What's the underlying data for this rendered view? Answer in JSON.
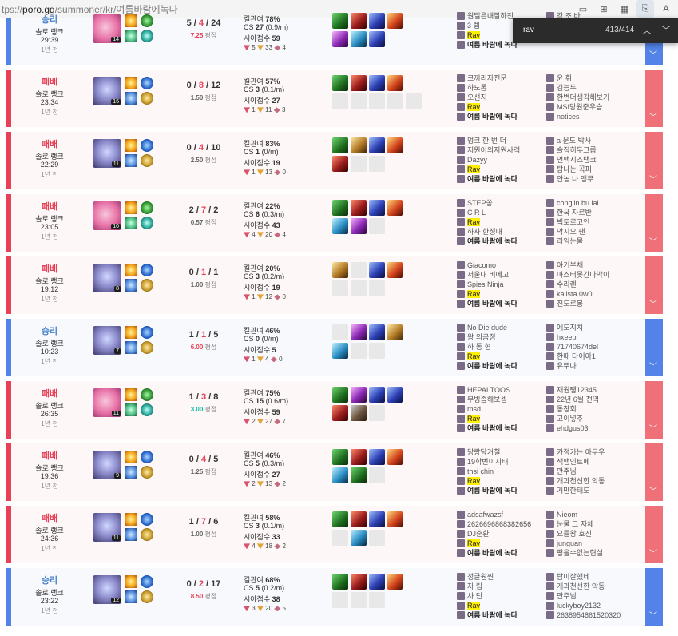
{
  "browser": {
    "url_prefix": "tps://",
    "url_domain": "poro.gg",
    "url_path": "/summoner/kr/여름바람에녹다"
  },
  "find": {
    "query": "rav",
    "count": "413/414"
  },
  "labels": {
    "kp": "킬관여",
    "cs": "CS",
    "vision": "시야점수",
    "avg": "평점"
  },
  "matches": [
    {
      "result": "승리",
      "status": "win",
      "queue": "솔로 랭크",
      "duration": "29:39",
      "ago": "1년 전",
      "champ": "seraphine",
      "level": "14",
      "spells": [
        "flash",
        "ghost"
      ],
      "runes": [
        "rune-g",
        "rune-t"
      ],
      "kills": "5",
      "deaths": "4",
      "assists": "24",
      "ratio": "7.25",
      "ratio_color": "red",
      "kp": "78%",
      "cs": "27",
      "cspm": "(0.9/m)",
      "vision": "59",
      "wards": [
        "5",
        "33",
        "4"
      ],
      "items": [
        "i-a",
        "i-b",
        "i-c",
        "i-d",
        "i-e",
        "i-f",
        "i-c"
      ],
      "team1": [
        "원딜은내잘하진",
        "3 렙",
        "Rav",
        "여름 바람에 녹다"
      ],
      "team2": [
        "강 조 바",
        "애기 미드"
      ],
      "first": true
    },
    {
      "result": "패배",
      "status": "loss",
      "queue": "솔로 랭크",
      "duration": "23:34",
      "ago": "1년 전",
      "champ": "gnar",
      "level": "16",
      "spells": [
        "flash",
        "mark"
      ],
      "runes": [
        "rune-b",
        "rune-y"
      ],
      "kills": "0",
      "deaths": "8",
      "assists": "12",
      "ratio": "1.50",
      "ratio_color": "",
      "kp": "57%",
      "cs": "3",
      "cspm": "(0.1/m)",
      "vision": "27",
      "wards": [
        "1",
        "11",
        "3"
      ],
      "items": [
        "i-a",
        "i-b",
        "i-c",
        "i-d",
        "",
        "",
        "",
        "",
        ""
      ],
      "team1": [
        "코끼리자전문",
        "하도롱",
        "오선지",
        "Rav",
        "여름 바람에 녹다"
      ],
      "team2": [
        "윤 휘",
        "김능두",
        "한변더생각해보기",
        "MSI당원준우승",
        "notices"
      ]
    },
    {
      "result": "패배",
      "status": "loss",
      "queue": "솔로 랭크",
      "duration": "22:29",
      "ago": "1년 전",
      "champ": "gnar",
      "level": "11",
      "spells": [
        "flash",
        "mark"
      ],
      "runes": [
        "rune-b",
        "rune-y"
      ],
      "kills": "0",
      "deaths": "4",
      "assists": "10",
      "ratio": "2.50",
      "ratio_color": "",
      "kp": "83%",
      "cs": "1",
      "cspm": "(0/m)",
      "vision": "19",
      "wards": [
        "1",
        "13",
        "0"
      ],
      "items": [
        "i-a",
        "i-g",
        "i-c",
        "i-d",
        "i-b",
        "",
        ""
      ],
      "team1": [
        "멍크 한 번 더",
        "지원이의지원사격",
        "Dazyy",
        "Rav",
        "여름 바람에 녹다"
      ],
      "team2": [
        "a 문도 박사",
        "솔직히두그룹",
        "연맥시즈탱크",
        "탐나는 꼭피",
        "안농 나 앵무"
      ]
    },
    {
      "result": "패배",
      "status": "loss",
      "queue": "솔로 랭크",
      "duration": "23:05",
      "ago": "1년 전",
      "champ": "seraphine",
      "level": "10",
      "spells": [
        "flash",
        "ghost"
      ],
      "runes": [
        "rune-g",
        "rune-t"
      ],
      "kills": "2",
      "deaths": "7",
      "assists": "2",
      "ratio": "0.57",
      "ratio_color": "",
      "kp": "22%",
      "cs": "6",
      "cspm": "(0.3/m)",
      "vision": "43",
      "wards": [
        "4",
        "20",
        "4"
      ],
      "items": [
        "i-a",
        "i-b",
        "i-c",
        "i-d",
        "i-f",
        "i-e",
        ""
      ],
      "team1": [
        "STEP쏭",
        "C R L",
        "Rav",
        "하사 한정대",
        "여름 바람에 녹다"
      ],
      "team2": [
        "conglin bu lai",
        "한국 자르반",
        "빅토르고인",
        "악시오 팬",
        "라임눈물"
      ]
    },
    {
      "result": "패배",
      "status": "loss",
      "queue": "솔로 랭크",
      "duration": "19:12",
      "ago": "1년 전",
      "champ": "gnar",
      "level": "8",
      "spells": [
        "flash",
        "mark"
      ],
      "runes": [
        "rune-b",
        "rune-y"
      ],
      "kills": "0",
      "deaths": "1",
      "assists": "1",
      "ratio": "1.00",
      "ratio_color": "",
      "kp": "20%",
      "cs": "3",
      "cspm": "(0.2/m)",
      "vision": "19",
      "wards": [
        "1",
        "12",
        "0"
      ],
      "items": [
        "i-g",
        "",
        "i-c",
        "i-d",
        "",
        "",
        ""
      ],
      "team1": [
        "Giacomo",
        "서울대 비에고",
        "Spies Ninja",
        "Rav",
        "여름 바람에 녹다"
      ],
      "team2": [
        "아기부채",
        "마스터못간다막이",
        "수리렌",
        "kalista 0w0",
        "진도로봉"
      ]
    },
    {
      "result": "승리",
      "status": "win",
      "queue": "솔로 랭크",
      "duration": "10:23",
      "ago": "1년 전",
      "champ": "gnar",
      "level": "7",
      "spells": [
        "flash",
        "mark"
      ],
      "runes": [
        "rune-b",
        "rune-y"
      ],
      "kills": "1",
      "deaths": "1",
      "assists": "5",
      "ratio": "6.00",
      "ratio_color": "red",
      "kp": "46%",
      "cs": "0",
      "cspm": "(0/m)",
      "vision": "5",
      "wards": [
        "1",
        "4",
        "0"
      ],
      "items": [
        "",
        "i-e",
        "i-c",
        "i-g",
        "i-f",
        "",
        ""
      ],
      "team1": [
        "No Die dude",
        "왕 의금정",
        "하 동 현",
        "Rav",
        "여름 바람에 녹다"
      ],
      "team2": [
        "에도지치",
        "hxeep",
        "71740674del",
        "한때 다이아1",
        "유뚜나"
      ]
    },
    {
      "result": "패배",
      "status": "loss",
      "queue": "솔로 랭크",
      "duration": "26:35",
      "ago": "1년 전",
      "champ": "seraphine",
      "level": "11",
      "spells": [
        "flash",
        "ghost"
      ],
      "runes": [
        "rune-g",
        "rune-t"
      ],
      "kills": "1",
      "deaths": "3",
      "assists": "8",
      "ratio": "3.00",
      "ratio_color": "green",
      "kp": "75%",
      "cs": "15",
      "cspm": "(0.6/m)",
      "vision": "59",
      "wards": [
        "2",
        "27",
        "7"
      ],
      "items": [
        "i-a",
        "i-e",
        "i-c",
        "i-c",
        "i-b",
        "i-h",
        ""
      ],
      "team1": [
        "HEPAI TOOS",
        "무빙좀해보셈",
        "msd",
        "Rav",
        "여름 바람에 녹다"
      ],
      "team2": [
        "재원쨍12345",
        "22년 6월 전역",
        "동창회",
        "고이넣추",
        "ehdgus03"
      ]
    },
    {
      "result": "패배",
      "status": "loss",
      "queue": "솔로 랭크",
      "duration": "19:36",
      "ago": "1년 전",
      "champ": "gnar",
      "level": "9",
      "spells": [
        "flash",
        "mark"
      ],
      "runes": [
        "rune-b",
        "rune-y"
      ],
      "kills": "0",
      "deaths": "4",
      "assists": "5",
      "ratio": "1.25",
      "ratio_color": "",
      "kp": "46%",
      "cs": "5",
      "cspm": "(0.3/m)",
      "vision": "27",
      "wards": [
        "2",
        "13",
        "2"
      ],
      "items": [
        "i-a",
        "i-b",
        "i-c",
        "i-d",
        "i-f",
        "i-a",
        ""
      ],
      "team1": [
        "당랑당거철",
        "19학번이지태",
        "thsi chin",
        "Rav",
        "여름 바람에 녹다"
      ],
      "team2": [
        "카정가는 아무우",
        "색맹인트페",
        "만주님",
        "개과천선한 악동",
        "거만한태도"
      ]
    },
    {
      "result": "패배",
      "status": "loss",
      "queue": "솔로 랭크",
      "duration": "24:36",
      "ago": "1년 전",
      "champ": "gnar",
      "level": "11",
      "spells": [
        "flash",
        "mark"
      ],
      "runes": [
        "rune-b",
        "rune-y"
      ],
      "kills": "1",
      "deaths": "7",
      "assists": "6",
      "ratio": "1.00",
      "ratio_color": "",
      "kp": "58%",
      "cs": "3",
      "cspm": "(0.1/m)",
      "vision": "33",
      "wards": [
        "4",
        "18",
        "2"
      ],
      "items": [
        "i-a",
        "i-b",
        "i-c",
        "i-d",
        "",
        "i-f",
        ""
      ],
      "team1": [
        "adsafwazsf",
        "2626696868382656",
        "DJ준환",
        "Rav",
        "여름 바람에 녹다"
      ],
      "team2": [
        "Nieom",
        "눈물 그 자체",
        "요들왕 호진",
        "junguan",
        "평을수없는현실"
      ]
    },
    {
      "result": "승리",
      "status": "win",
      "queue": "솔로 랭크",
      "duration": "23:22",
      "ago": "1년 전",
      "champ": "gnar",
      "level": "12",
      "spells": [
        "flash",
        "mark"
      ],
      "runes": [
        "rune-b",
        "rune-y"
      ],
      "kills": "0",
      "deaths": "2",
      "assists": "17",
      "ratio": "8.50",
      "ratio_color": "red",
      "kp": "68%",
      "cs": "5",
      "cspm": "(0.2/m)",
      "vision": "38",
      "wards": [
        "3",
        "20",
        "5"
      ],
      "items": [
        "i-a",
        "i-b",
        "i-c",
        "i-d",
        "",
        "",
        ""
      ],
      "team1": [
        "정글원찐",
        "자 림",
        "사 딘",
        "Rav",
        "여름 바람에 녹다"
      ],
      "team2": [
        "탑이잘했네",
        "개과천선한 악동",
        "만주님",
        "luckyboy2132",
        "2638954861520320"
      ]
    }
  ]
}
